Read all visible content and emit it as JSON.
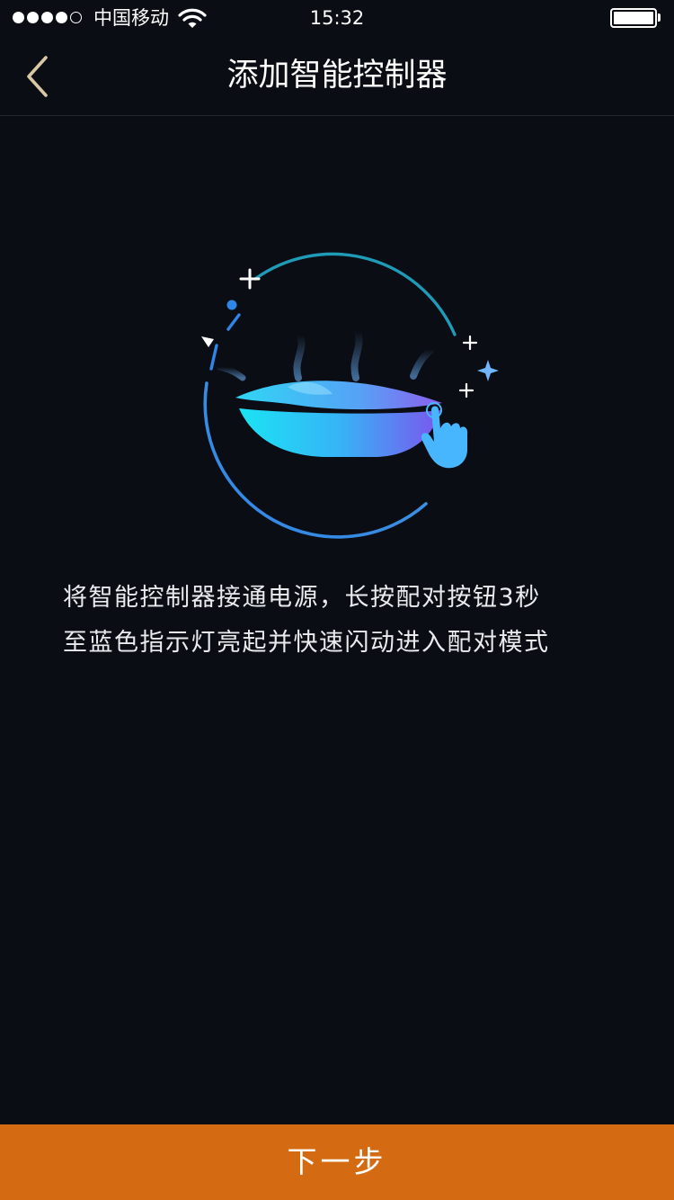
{
  "status_bar": {
    "carrier": "中国移动",
    "time": "15:32",
    "signal_bars_filled": 4,
    "signal_bars_total": 5,
    "battery_level": 1.0
  },
  "nav": {
    "title": "添加智能控制器",
    "back_icon": "chevron-left-icon"
  },
  "illustration": {
    "icon": "smart-controller-pairing-illustration"
  },
  "instruction": {
    "line1": "将智能控制器接通电源，长按配对按钮3秒",
    "line2": "至蓝色指示灯亮起并快速闪动进入配对模式"
  },
  "footer": {
    "next_label": "下一步"
  },
  "colors": {
    "background": "#0a0d13",
    "accent": "#d46b12",
    "ring": "#3a8fe0"
  }
}
